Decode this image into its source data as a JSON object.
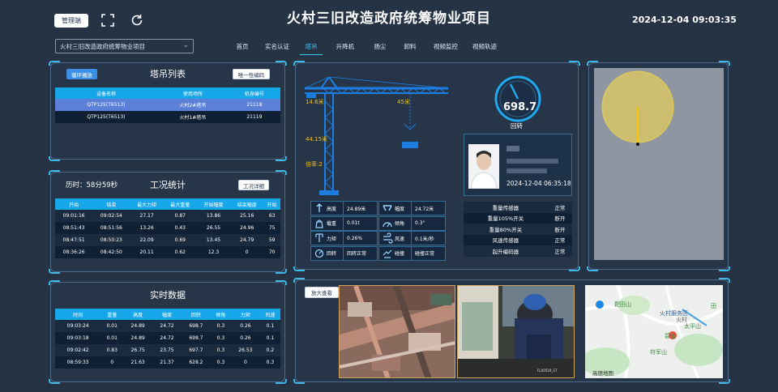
{
  "header": {
    "manage_label": "管理端",
    "title": "火村三旧改造政府统筹物业项目",
    "datetime": "2024-12-04 09:03:35",
    "project_select": "火村三旧改造政府统筹物业项目"
  },
  "nav": {
    "tabs": [
      "首页",
      "实名认证",
      "塔吊",
      "升降机",
      "扬尘",
      "卸料",
      "视频监控",
      "视频轨迹"
    ],
    "active_index": 2
  },
  "crane_list": {
    "title": "塔吊列表",
    "toggle_label": "循环播放",
    "code_btn": "唯一性编码",
    "columns": [
      "设备名称",
      "使用场所",
      "机身编号"
    ],
    "rows": [
      [
        "QTP125(T6513)",
        "火村2#塔吊",
        "21118"
      ],
      [
        "QTP125(T6513)",
        "火村1#塔吊",
        "21119"
      ]
    ]
  },
  "work_stats": {
    "duration": "历时：58分59秒",
    "title": "工况统计",
    "btn": "工况详细",
    "columns": [
      "开始",
      "结束",
      "最大力矩",
      "最大重量",
      "开始幅度",
      "结束幅度",
      "开始"
    ],
    "rows": [
      [
        "09:01:16",
        "09:02:54",
        "27.17",
        "0.87",
        "13.86",
        "25.16",
        "63"
      ],
      [
        "08:51:43",
        "08:51:56",
        "13.26",
        "0.43",
        "26.55",
        "24.96",
        "75"
      ],
      [
        "08:47:51",
        "08:50:23",
        "22.09",
        "0.69",
        "13.45",
        "24.79",
        "59"
      ],
      [
        "08:36:26",
        "08:42:50",
        "20.11",
        "0.62",
        "12.3",
        "0",
        "70"
      ]
    ]
  },
  "realtime": {
    "title": "实时数据",
    "columns": [
      "时间",
      "重量",
      "高度",
      "幅度",
      "回转",
      "倾角",
      "力矩",
      "风速"
    ],
    "rows": [
      [
        "09:03:24",
        "0.01",
        "24.89",
        "24.72",
        "698.7",
        "0.3",
        "0.26",
        "0.1"
      ],
      [
        "09:03:18",
        "0.01",
        "24.89",
        "24.72",
        "698.7",
        "0.3",
        "0.26",
        "0.1"
      ],
      [
        "09:02:42",
        "0.83",
        "26.75",
        "23.75",
        "697.7",
        "0.3",
        "26.53",
        "0.2"
      ],
      [
        "08:59:33",
        "0",
        "21.63",
        "21.37",
        "628.2",
        "0.3",
        "0",
        "0.3"
      ]
    ]
  },
  "crane": {
    "left_arm": "14.6米",
    "right_arm": "45米",
    "height": "44.15米",
    "ratio": "倍率:2",
    "rotation_value": "698.7",
    "rotation_label": "回转",
    "params": [
      {
        "icon": "height-icon",
        "label": "高度",
        "value": "24.89米"
      },
      {
        "icon": "amplitude-icon",
        "label": "幅度",
        "value": "24.72米"
      },
      {
        "icon": "weight-icon",
        "label": "载重",
        "value": "0.01t"
      },
      {
        "icon": "tilt-icon",
        "label": "倾角",
        "value": "0.3°"
      },
      {
        "icon": "moment-icon",
        "label": "力矩",
        "value": "0.26%"
      },
      {
        "icon": "wind-icon",
        "label": "风速",
        "value": "0.1米/秒"
      },
      {
        "icon": "rotation-icon",
        "label": "回转",
        "value": "回转正常"
      },
      {
        "icon": "collision-icon",
        "label": "碰撞",
        "value": "碰撞正常"
      }
    ]
  },
  "driver": {
    "time": "2024-12-04 06:35:18"
  },
  "sensors": [
    [
      "重量传感器",
      "正常"
    ],
    [
      "重量105%开关",
      "断开"
    ],
    [
      "重量80%开关",
      "断开"
    ],
    [
      "风速传感器",
      "正常"
    ],
    [
      "起升编码器",
      "正常"
    ]
  ],
  "video": {
    "enlarge_label": "放大查看"
  },
  "map": {
    "labels": [
      "靶田山",
      "火村服务区",
      "田",
      "火村",
      "太平山",
      "碧山",
      "符军山",
      "高德地图"
    ]
  },
  "colors": {
    "accent": "#36c7f2",
    "header_row": "#16a7e8",
    "selected_row": "#5c7fd8",
    "crane_blue": "#1c7ee3",
    "arm_label": "#f0c419"
  }
}
